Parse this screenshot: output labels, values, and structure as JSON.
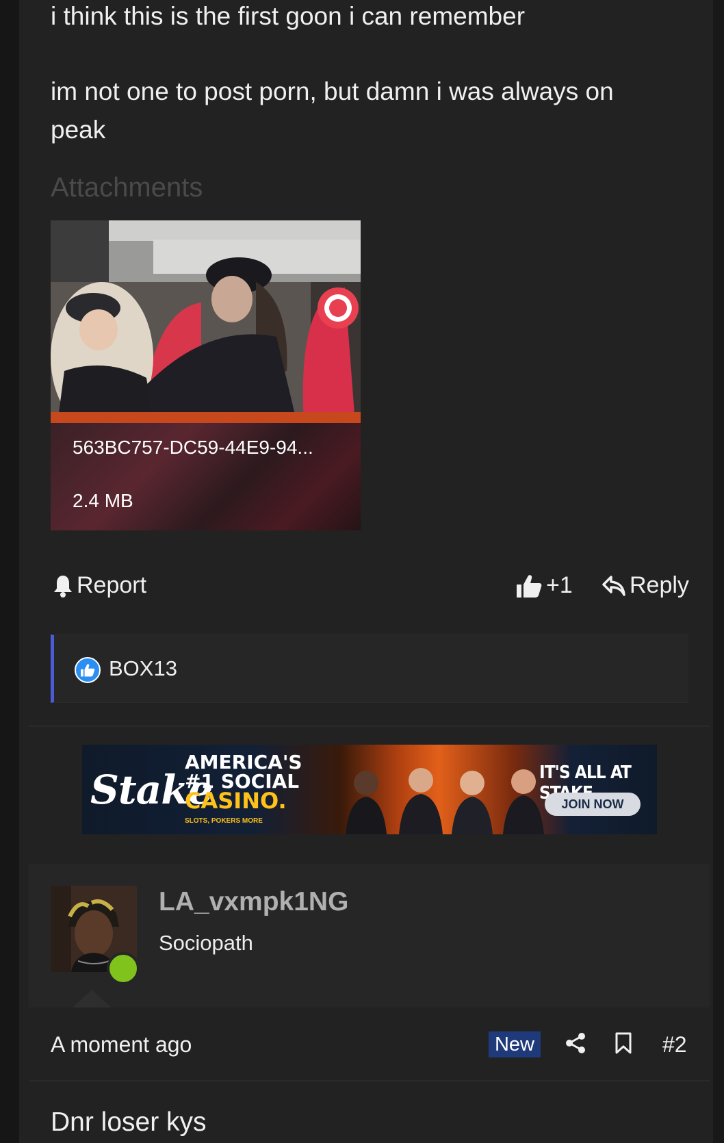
{
  "post": {
    "message_lines": [
      "i think this is the first goon i can remember",
      "im not one to post porn, but damn i was always on",
      "peak"
    ],
    "attachments_title": "Attachments",
    "attachment": {
      "file_name": "563BC757-DC59-44E9-94...",
      "file_size": "2.4 MB"
    },
    "actions": {
      "report": "Report",
      "like_count": "+1",
      "reply": "Reply"
    },
    "reactions": {
      "user": "BOX13"
    }
  },
  "ad": {
    "logo": "Stake",
    "headline_1": "AMERICA'S",
    "headline_2": "#1 SOCIAL",
    "headline_3": "CASINO.",
    "sub": "SLOTS, POKERS MORE",
    "tagline": "IT'S ALL AT STAKE",
    "cta": "JOIN NOW"
  },
  "next_post": {
    "author": {
      "name": "LA_vxmpk1NG",
      "title": "Sociopath"
    },
    "meta": {
      "time": "A moment ago",
      "badge": "New",
      "post_number": "#2"
    },
    "message": "Dnr loser kys"
  },
  "colors": {
    "background": "#222222",
    "accent_blue": "#4b5ad6",
    "new_badge": "#1f3a7a",
    "online": "#7fc31c"
  }
}
